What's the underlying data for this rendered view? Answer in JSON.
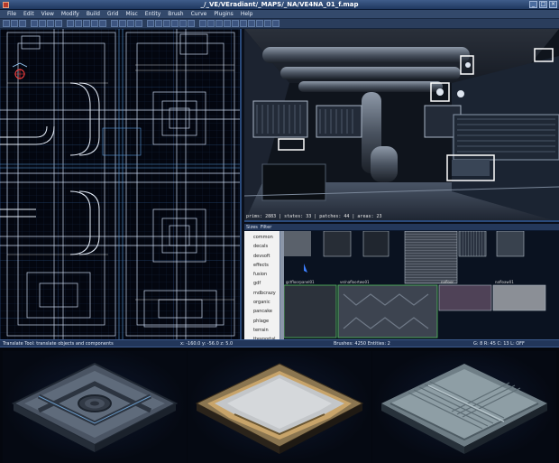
{
  "window": {
    "title": "_/_VE/VEradiant/_MAPS/_NA/VE4NA_01_f.map"
  },
  "menu": [
    "File",
    "Edit",
    "View",
    "Modify",
    "Build",
    "Grid",
    "Misc",
    "Entity",
    "Brush",
    "Curve",
    "Plugins",
    "Help"
  ],
  "camera": {
    "status": "prims: 2883 | states: 33 | patches: 44 | areas: 23"
  },
  "texture_browser": {
    "tabs": [
      "Sizes",
      "Filter"
    ],
    "folders": [
      "common",
      "decals",
      "devsoft",
      "effects",
      "fusion",
      "gdf",
      "mdbcrazy",
      "organic",
      "pancake",
      "phlage",
      "terrain",
      "ttexportal",
      "ve1"
    ],
    "selected_folder": "ve1",
    "labels": [
      "gctfloorpanel01",
      "ve/nafloortwo01",
      "nafloor",
      "nafloaw01"
    ]
  },
  "status": {
    "left": "Translate Tool: translate objects and components",
    "coords": "x: -160.0   y: -56.0   z: 5.0",
    "counts": "Brushes: 4250  Entities: 2",
    "grid": "G: 8  R: 45  C: 13  L: OFF"
  }
}
